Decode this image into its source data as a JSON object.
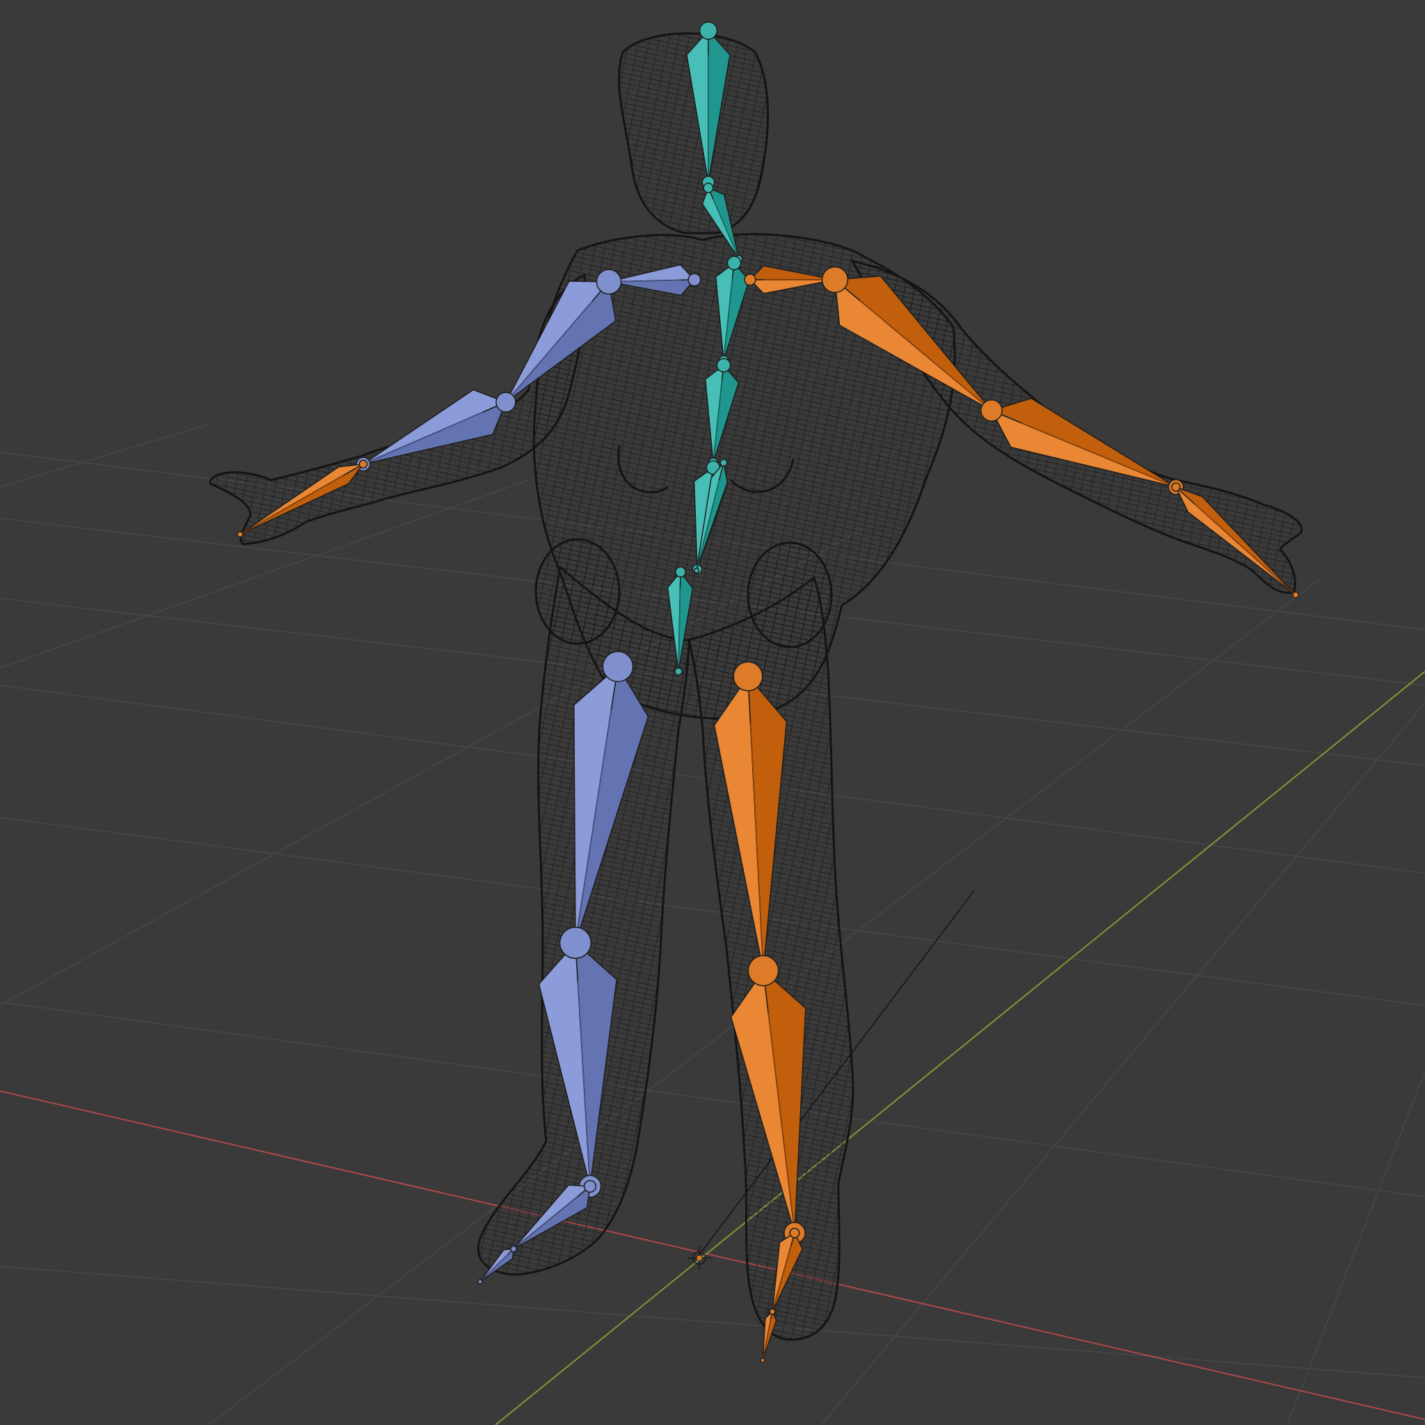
{
  "viewport": {
    "background_color": "#3a3a3a",
    "grid_color": "#474747",
    "axis_x_color": "#b0484a",
    "axis_y_color": "#7f9a36",
    "mesh_wire_color": "#141414",
    "origin_marker_color": "#e07a20"
  },
  "armature": {
    "center_bone_color": "#36ada4",
    "left_bone_color": "#7a8ac8",
    "right_bone_color": "#d77522",
    "bone_names": [
      "head",
      "neck",
      "spine-upper",
      "spine-mid",
      "spine-lower",
      "spine-base",
      "hips",
      "shoulder-left",
      "upper-arm-left",
      "forearm-left",
      "hand-left",
      "shoulder-right",
      "upper-arm-right",
      "forearm-right",
      "hand-right",
      "thigh-left",
      "shin-left",
      "foot-left",
      "toe-left",
      "thigh-right",
      "shin-right",
      "foot-right",
      "toe-right"
    ]
  },
  "icons": {
    "origin": "3d-cursor-icon"
  }
}
